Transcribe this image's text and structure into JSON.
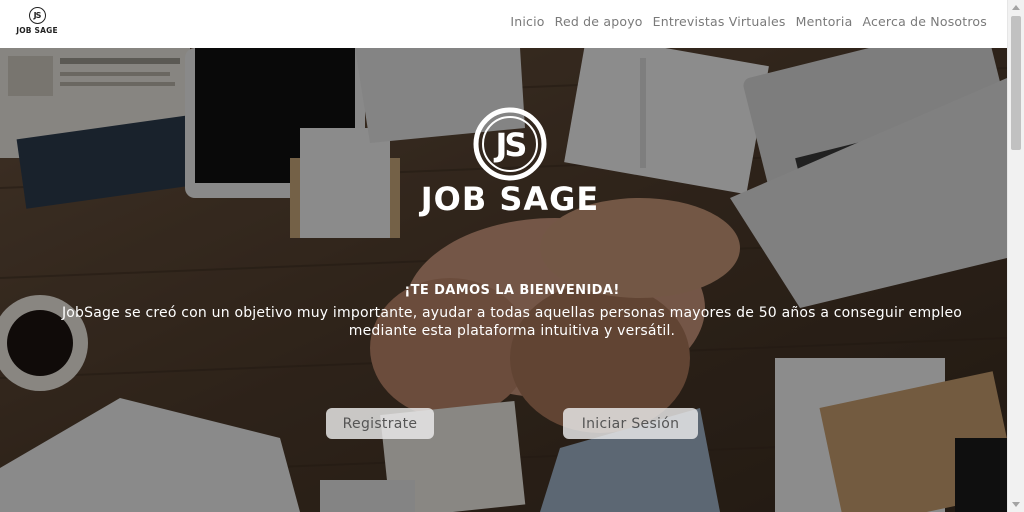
{
  "brand": {
    "logo_initials": "JS",
    "logo_text": "JOB SAGE"
  },
  "nav": {
    "items": [
      {
        "label": "Inicio"
      },
      {
        "label": "Red de apoyo"
      },
      {
        "label": "Entrevistas Virtuales"
      },
      {
        "label": "Mentoria"
      },
      {
        "label": "Acerca de Nosotros"
      }
    ]
  },
  "hero": {
    "logo_initials": "JS",
    "title": "JOB SAGE",
    "welcome": "¡TE DAMOS LA BIENVENIDA!",
    "description": "JobSage se creó con un objetivo muy importante, ayudar a todas aquellas personas mayores de 50 años a conseguir empleo mediante esta plataforma intuitiva y versátil.",
    "register_label": "Registrate",
    "login_label": "Iniciar Sesión"
  },
  "colors": {
    "nav_text": "#7a7a7a",
    "hero_text": "#ffffff",
    "button_bg": "#ebebeb"
  }
}
